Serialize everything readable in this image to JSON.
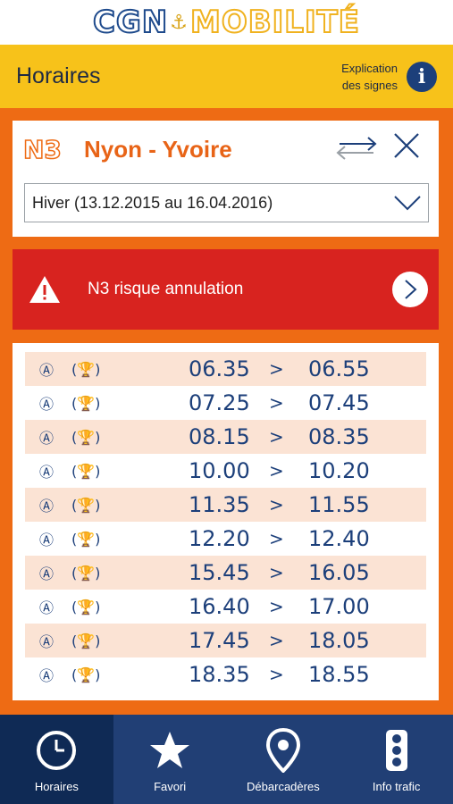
{
  "brand": {
    "part1": "CGN",
    "anchor": "⚓",
    "part2": "MOBILITÉ"
  },
  "header": {
    "title": "Horaires",
    "legend_line1": "Explication",
    "legend_line2": "des signes",
    "info_label": "i"
  },
  "route": {
    "line": "N3",
    "name": "Nyon - Yvoire",
    "season": "Hiver (13.12.2015 au 16.04.2016)"
  },
  "alert": {
    "text": "N3 risque annulation"
  },
  "schedule": {
    "symbol_a": "Ⓐ",
    "symbol_cup": "(🏆)",
    "separator": ">",
    "rows": [
      {
        "dep": "06.35",
        "arr": "06.55"
      },
      {
        "dep": "07.25",
        "arr": "07.45"
      },
      {
        "dep": "08.15",
        "arr": "08.35"
      },
      {
        "dep": "10.00",
        "arr": "10.20"
      },
      {
        "dep": "11.35",
        "arr": "11.55"
      },
      {
        "dep": "12.20",
        "arr": "12.40"
      },
      {
        "dep": "15.45",
        "arr": "16.05"
      },
      {
        "dep": "16.40",
        "arr": "17.00"
      },
      {
        "dep": "17.45",
        "arr": "18.05"
      },
      {
        "dep": "18.35",
        "arr": "18.55"
      }
    ]
  },
  "nav": [
    {
      "label": "Horaires",
      "icon": "clock-icon"
    },
    {
      "label": "Favori",
      "icon": "star-icon"
    },
    {
      "label": "Débarcadères",
      "icon": "map-pin-icon"
    },
    {
      "label": "Info trafic",
      "icon": "traffic-light-icon"
    }
  ],
  "colors": {
    "orange": "#ee6b14",
    "yellow": "#f7c21a",
    "navy": "#213f75",
    "red": "#d8231f",
    "row_shade": "#fbe3d4"
  }
}
